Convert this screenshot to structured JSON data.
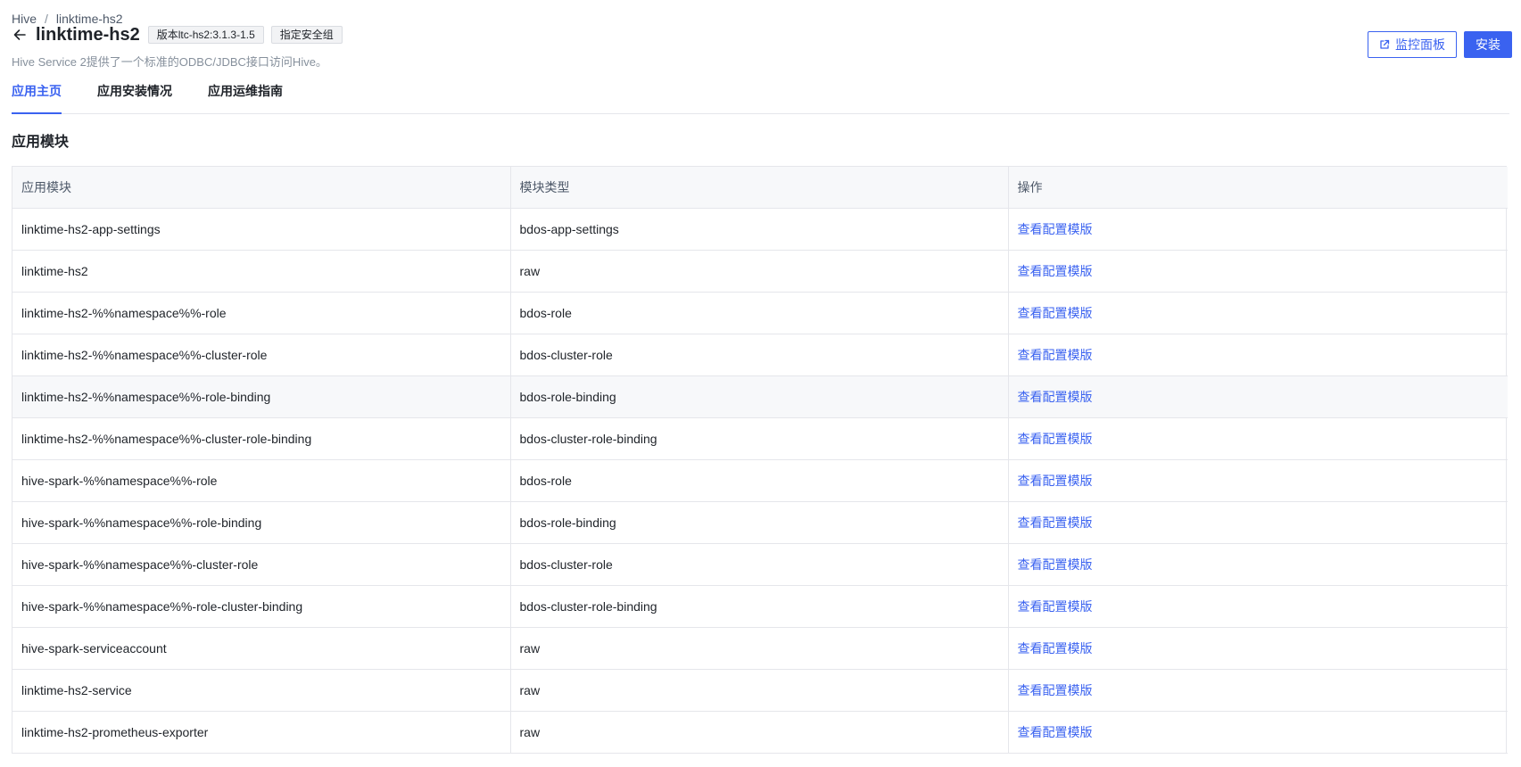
{
  "breadcrumb": {
    "root": "Hive",
    "separator": "/",
    "current": "linktime-hs2"
  },
  "header": {
    "title": "linktime-hs2",
    "version_tag": "版本ltc-hs2:3.1.3-1.5",
    "security_tag": "指定安全组",
    "description": "Hive Service 2提供了一个标准的ODBC/JDBC接口访问Hive。",
    "monitor_button": "监控面板",
    "install_button": "安装"
  },
  "tabs": [
    {
      "label": "应用主页",
      "active": true
    },
    {
      "label": "应用安装情况",
      "active": false
    },
    {
      "label": "应用运维指南",
      "active": false
    }
  ],
  "section": {
    "title": "应用模块"
  },
  "table": {
    "columns": [
      "应用模块",
      "模块类型",
      "操作"
    ],
    "rows": [
      {
        "module": "linktime-hs2-app-settings",
        "type": "bdos-app-settings",
        "action": "查看配置模版"
      },
      {
        "module": "linktime-hs2",
        "type": "raw",
        "action": "查看配置模版"
      },
      {
        "module": "linktime-hs2-%%namespace%%-role",
        "type": "bdos-role",
        "action": "查看配置模版"
      },
      {
        "module": "linktime-hs2-%%namespace%%-cluster-role",
        "type": "bdos-cluster-role",
        "action": "查看配置模版"
      },
      {
        "module": "linktime-hs2-%%namespace%%-role-binding",
        "type": "bdos-role-binding",
        "action": "查看配置模版"
      },
      {
        "module": "linktime-hs2-%%namespace%%-cluster-role-binding",
        "type": "bdos-cluster-role-binding",
        "action": "查看配置模版"
      },
      {
        "module": "hive-spark-%%namespace%%-role",
        "type": "bdos-role",
        "action": "查看配置模版"
      },
      {
        "module": "hive-spark-%%namespace%%-role-binding",
        "type": "bdos-role-binding",
        "action": "查看配置模版"
      },
      {
        "module": "hive-spark-%%namespace%%-cluster-role",
        "type": "bdos-cluster-role",
        "action": "查看配置模版"
      },
      {
        "module": "hive-spark-%%namespace%%-role-cluster-binding",
        "type": "bdos-cluster-role-binding",
        "action": "查看配置模版"
      },
      {
        "module": "hive-spark-serviceaccount",
        "type": "raw",
        "action": "查看配置模版"
      },
      {
        "module": "linktime-hs2-service",
        "type": "raw",
        "action": "查看配置模版"
      },
      {
        "module": "linktime-hs2-prometheus-exporter",
        "type": "raw",
        "action": "查看配置模版"
      }
    ]
  },
  "icons": {
    "back": "arrow-left-icon",
    "external": "external-link-icon"
  },
  "colors": {
    "accent": "#3a62f0",
    "text": "#1f2329",
    "muted": "#86909c",
    "border": "#e5e6eb"
  }
}
